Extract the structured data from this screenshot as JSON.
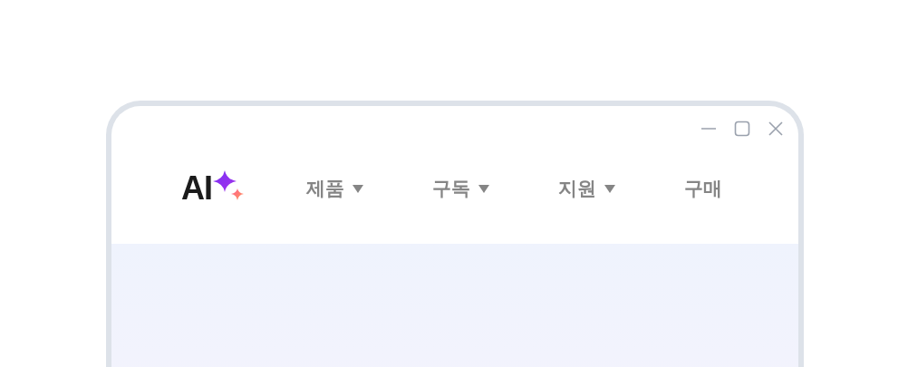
{
  "logo": {
    "text": "AI"
  },
  "window_controls": [
    {
      "kind": "minimize"
    },
    {
      "kind": "maximize"
    },
    {
      "kind": "close"
    }
  ],
  "nav": [
    {
      "label": "제품",
      "has_menu": true
    },
    {
      "label": "구독",
      "has_menu": true
    },
    {
      "label": "지원",
      "has_menu": true
    },
    {
      "label": "구매",
      "has_menu": false
    }
  ]
}
